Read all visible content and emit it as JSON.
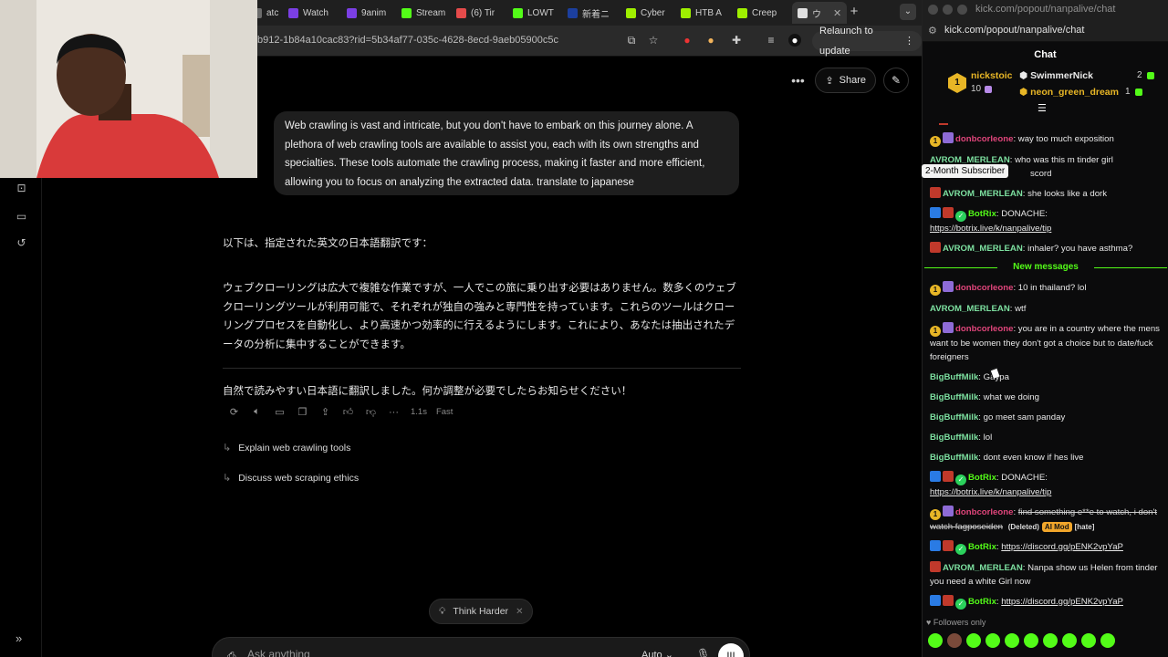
{
  "browser": {
    "tabs": [
      {
        "label": "atch",
        "color": "#6c6c6c"
      },
      {
        "label": "Watch",
        "color": "#7b3fe4"
      },
      {
        "label": "9anim",
        "color": "#7b3fe4"
      },
      {
        "label": "Stream",
        "color": "#53fc18"
      },
      {
        "label": "(6) Tir",
        "color": "#e54b4b"
      },
      {
        "label": "LOWT",
        "color": "#53fc18"
      },
      {
        "label": "新着ニ",
        "color": "#1c3f9e"
      },
      {
        "label": "Cyber",
        "color": "#9fef00"
      },
      {
        "label": "HTB A",
        "color": "#9fef00"
      },
      {
        "label": "Creep",
        "color": "#9fef00"
      },
      {
        "label": "ウ",
        "color": "#e0e0e0"
      }
    ],
    "url": "b912-1b84a10cac83?rid=5b34af77-035c-4628-8ecd-9aeb05900c5c",
    "relaunch_label": "Relaunch to update"
  },
  "chat_app": {
    "share_label": "Share",
    "user_message": "Web crawling is vast and intricate, but you don't have to embark on this journey alone. A plethora of web crawling tools are available to assist you, each with its own strengths and specialties. These tools automate the crawling process, making it faster and more efficient, allowing you to focus on analyzing the extracted data. translate to japanese",
    "reply_intro": "以下は、指定された英文の日本語翻訳です：",
    "reply_body": "ウェブクローリングは広大で複雑な作業ですが、一人でこの旅に乗り出す必要はありません。数多くのウェブクローリングツールが利用可能で、それぞれが独自の強みと専門性を持っています。これらのツールはクローリングプロセスを自動化し、より高速かつ効率的に行えるようにします。これにより、あなたは抽出されたデータの分析に集中することができます。",
    "reply_outro": "自然で読みやすい日本語に翻訳しました。何か調整が必要でしたらお知らせください！",
    "response_time": "1.1s",
    "response_mode": "Fast",
    "followups": [
      "Explain web crawling tools",
      "Discuss web scraping ethics"
    ],
    "think_label": "Think Harder",
    "input_placeholder": "Ask anything",
    "mode_label": "Auto"
  },
  "kick": {
    "window_title": "kick.com/popout/nanpalive/chat",
    "url": "kick.com/popout/nanpalive/chat",
    "header": "Chat",
    "leaderboard": {
      "rank": "1",
      "top_user": "nickstoic",
      "top_count": "10",
      "second_user": "SwimmerNick",
      "second_count": "2",
      "third_user": "neon_green_dream",
      "third_count": "1"
    },
    "tooltip": "2-Month Subscriber",
    "new_messages_label": "New messages",
    "messages_before": [
      {
        "user": "donbcorleone",
        "color": "#e0457b",
        "badges": [
          "sub",
          "purple"
        ],
        "text": "way too much exposition"
      },
      {
        "user": "AVROM_MERLEAN",
        "color": "#7de0a0",
        "badges": [],
        "text": "who was this m tinder girl",
        "extra": "scord"
      },
      {
        "user": "AVROM_MERLEAN",
        "color": "#7de0a0",
        "badges": [
          "red"
        ],
        "text": "she looks like a dork"
      },
      {
        "user": "BotRix",
        "color": "#53fc18",
        "badges": [
          "blue",
          "red",
          "ver"
        ],
        "text": "DONACHE:",
        "link": "https://botrix.live/k/nanpalive/tip"
      },
      {
        "user": "AVROM_MERLEAN",
        "color": "#7de0a0",
        "badges": [
          "red"
        ],
        "text": "inhaler? you have asthma?"
      }
    ],
    "messages_after": [
      {
        "user": "donbcorleone",
        "color": "#e0457b",
        "badges": [
          "sub",
          "purple"
        ],
        "text": "10 in thailand? lol"
      },
      {
        "user": "AVROM_MERLEAN",
        "color": "#7de0a0",
        "badges": [],
        "text": "wtf"
      },
      {
        "user": "donbcorleone",
        "color": "#e0457b",
        "badges": [
          "sub",
          "purple"
        ],
        "text": "you are in a country where the mens want to be women they don't got a choice but to date/fuck foreigners"
      },
      {
        "user": "BigBuffMilk",
        "color": "#7de0a0",
        "badges": [],
        "text": "Gaypa"
      },
      {
        "user": "BigBuffMilk",
        "color": "#7de0a0",
        "badges": [],
        "text": "what we doing"
      },
      {
        "user": "BigBuffMilk",
        "color": "#7de0a0",
        "badges": [],
        "text": "go meet sam panday"
      },
      {
        "user": "BigBuffMilk",
        "color": "#7de0a0",
        "badges": [],
        "text": "lol"
      },
      {
        "user": "BigBuffMilk",
        "color": "#7de0a0",
        "badges": [],
        "text": "dont even know if hes live"
      },
      {
        "user": "BotRix",
        "color": "#53fc18",
        "badges": [
          "blue",
          "red",
          "ver"
        ],
        "text": "DONACHE:",
        "link": "https://botrix.live/k/nanpalive/tip"
      },
      {
        "user": "donbcorleone",
        "color": "#e0457b",
        "badges": [
          "sub",
          "purple"
        ],
        "text": "find something e**e to watch, i don't watch fagposeiden",
        "deleted": true,
        "deleted_label": "(Deleted)",
        "mod_label": "AI Mod",
        "reason": "[hate]"
      },
      {
        "user": "BotRix",
        "color": "#53fc18",
        "badges": [
          "blue",
          "red",
          "ver"
        ],
        "text": "",
        "link": "https://discord.gg/pENK2vpYaP"
      },
      {
        "user": "AVROM_MERLEAN",
        "color": "#7de0a0",
        "badges": [
          "red"
        ],
        "text": "Nanpa show us Helen from tinder you need a white Girl now"
      },
      {
        "user": "BotRix",
        "color": "#53fc18",
        "badges": [
          "blue",
          "red",
          "ver"
        ],
        "text": "",
        "link": "https://discord.gg/pENK2vpYaP"
      }
    ],
    "followers_only": "Followers only"
  }
}
